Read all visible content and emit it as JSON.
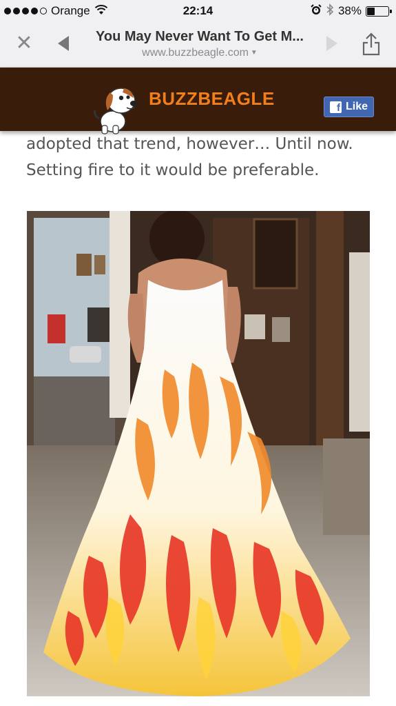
{
  "status_bar": {
    "carrier": "Orange",
    "time": "22:14",
    "battery": "38%",
    "battery_level": 0.38
  },
  "browser": {
    "title": "You May Never Want To Get M...",
    "url": "www.buzzbeagle.com"
  },
  "site_header": {
    "logo_text": "BUZZBEAGLE",
    "like_label": "Like"
  },
  "article": {
    "lines": [
      "adopted that trend, however… Until now.",
      "Setting fire to it would be preferable."
    ]
  },
  "icons": {
    "close": "close-icon",
    "back": "back-arrow-icon",
    "forward": "forward-arrow-icon",
    "share": "share-icon",
    "wifi": "wifi-icon",
    "alarm": "alarm-icon",
    "bluetooth": "bluetooth-icon",
    "battery": "battery-icon"
  },
  "colors": {
    "header_bg": "#3a1c0b",
    "brand_orange": "#f07f1c",
    "facebook_blue": "#4267b2"
  }
}
